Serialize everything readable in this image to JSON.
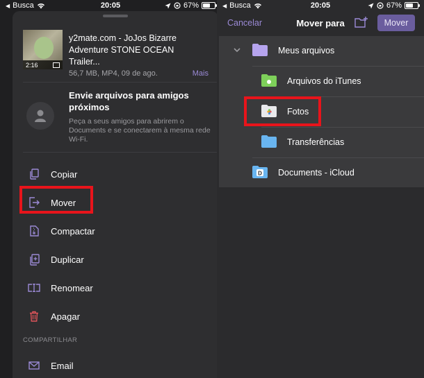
{
  "status_left": {
    "carrier": "Busca",
    "time": "20:05",
    "battery": "67%",
    "battery_level": 0.67
  },
  "status_right": {
    "carrier": "Busca",
    "time": "20:05",
    "battery": "67%",
    "battery_level": 0.67
  },
  "file": {
    "title": "y2mate.com - JoJos Bizarre Adventure STONE OCEAN  Trailer...",
    "duration": "2:16",
    "meta": "56,7 MB, MP4, 09 de ago.",
    "more": "Mais"
  },
  "nearby": {
    "title": "Envie arquivos para amigos próximos",
    "description": "Peça a seus amigos para abrirem o Documents e se conectarem à mesma rede Wi-Fi."
  },
  "actions": [
    {
      "label": "Copiar",
      "icon": "copy-icon"
    },
    {
      "label": "Mover",
      "icon": "move-icon"
    },
    {
      "label": "Compactar",
      "icon": "zip-icon"
    },
    {
      "label": "Duplicar",
      "icon": "duplicate-icon"
    },
    {
      "label": "Renomear",
      "icon": "rename-icon"
    },
    {
      "label": "Apagar",
      "icon": "trash-icon"
    }
  ],
  "share_section": {
    "header": "COMPARTILHAR",
    "email": "Email"
  },
  "move_sheet": {
    "cancel": "Cancelar",
    "title": "Mover para",
    "move": "Mover",
    "folders": [
      {
        "label": "Meus arquivos",
        "icon": "folder-icon"
      },
      {
        "label": "Arquivos do iTunes",
        "icon": "itunes-folder-icon"
      },
      {
        "label": "Fotos",
        "icon": "photos-folder-icon"
      },
      {
        "label": "Transferências",
        "icon": "folder-icon"
      },
      {
        "label": "Documents - iCloud",
        "icon": "icloud-documents-icon"
      }
    ]
  },
  "colors": {
    "accent": "#9b8ad6",
    "highlight": "#e8141b",
    "folder": "#b6a4ee",
    "folder_blue": "#69b5f0",
    "trash": "#e0555a"
  }
}
